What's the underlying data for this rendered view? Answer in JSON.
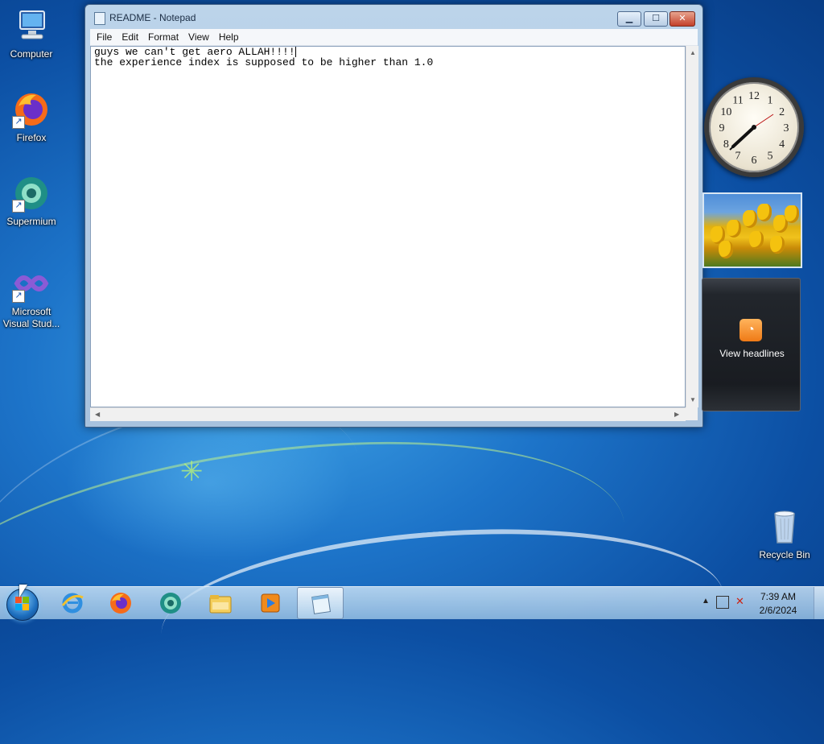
{
  "desktop": {
    "icons": [
      {
        "label": "Computer",
        "icon": "computer-icon"
      },
      {
        "label": "Firefox",
        "icon": "firefox-icon"
      },
      {
        "label": "Supermium",
        "icon": "supermium-icon"
      },
      {
        "label": "Microsoft Visual Stud...",
        "icon": "visual-studio-icon"
      },
      {
        "label": "Recycle Bin",
        "icon": "recycle-bin-icon"
      }
    ]
  },
  "notepad": {
    "title": "README - Notepad",
    "menu": [
      "File",
      "Edit",
      "Format",
      "View",
      "Help"
    ],
    "lines": [
      "guys we can't get aero ALLAH!!!!",
      "the experience index is supposed to be higher than 1.0"
    ],
    "buttons": {
      "minimize": "▁",
      "maximize": "☐",
      "close": "✕"
    }
  },
  "gadgets": {
    "clock": {
      "numbers": [
        "12",
        "1",
        "2",
        "3",
        "4",
        "5",
        "6",
        "7",
        "8",
        "9",
        "10",
        "11"
      ],
      "time": "7:39"
    },
    "feed": {
      "label": "View headlines"
    }
  },
  "taskbar": {
    "apps": [
      "internet-explorer-icon",
      "firefox-icon",
      "supermium-icon",
      "file-explorer-icon",
      "media-player-icon",
      "notepad-icon"
    ],
    "clock_time": "7:39 AM",
    "clock_date": "2/6/2024"
  },
  "colors": {
    "accent": "#1d74c9"
  }
}
